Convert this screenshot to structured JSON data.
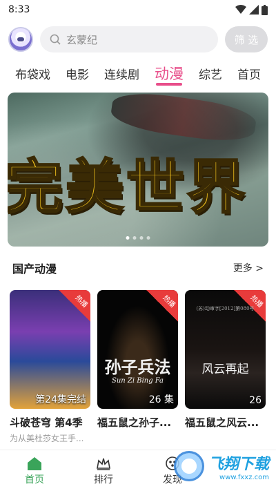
{
  "status": {
    "time": "8:33"
  },
  "search": {
    "placeholder": "玄蒙纪",
    "filter_label": "筛 选"
  },
  "tabs": [
    "布袋戏",
    "电影",
    "连续剧",
    "动漫",
    "综艺",
    "首页"
  ],
  "active_tab": "动漫",
  "banner": {
    "title": "完美世界"
  },
  "section": {
    "title": "国产动漫",
    "more": "更多 >"
  },
  "cards": [
    {
      "badge": "热播",
      "episode": "第24集完结",
      "title": "斗破苍穹 第4季",
      "subtitle": "为从美杜莎女王手..."
    },
    {
      "badge": "热播",
      "episode": "26 集",
      "title": "福五鼠之孙子...",
      "subtitle": "",
      "poster_text": "孙子兵法",
      "poster_sub": "Sun Zi Bing Fa"
    },
    {
      "badge": "热播",
      "episode": "26",
      "title": "福五鼠之风云...",
      "subtitle": "",
      "poster_text": "风云再起",
      "poster_top": "(苏)动审字[2012]第080号"
    }
  ],
  "nav": [
    {
      "label": "首页",
      "icon": "home-icon"
    },
    {
      "label": "排行",
      "icon": "crown-icon"
    },
    {
      "label": "发现",
      "icon": "discover-icon"
    }
  ],
  "watermark": {
    "text": "飞翔下载",
    "url": "www.fxxz.com"
  },
  "colors": {
    "accent": "#e84e8a",
    "nav_active": "#3aa45a",
    "hot_badge": "#e83b3b"
  }
}
